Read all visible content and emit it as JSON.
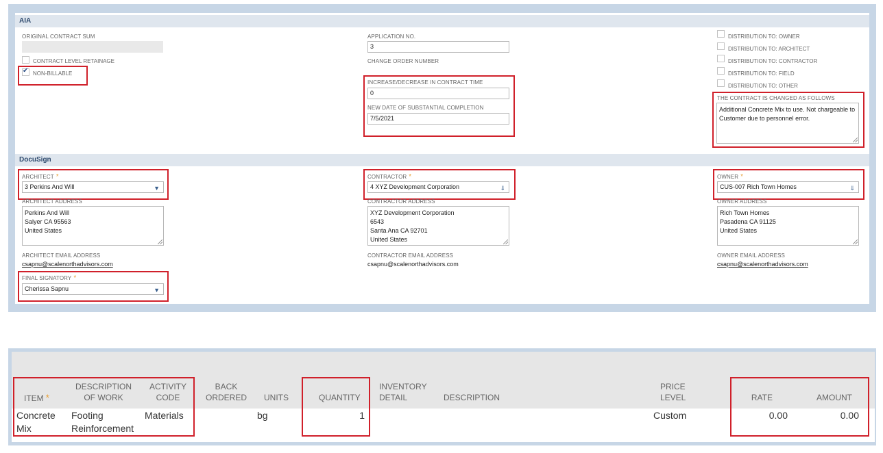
{
  "aia": {
    "section_title": "AIA",
    "original_contract_sum_label": "ORIGINAL CONTRACT SUM",
    "original_contract_sum_value": "",
    "contract_level_retainage_label": "CONTRACT LEVEL RETAINAGE",
    "contract_level_retainage_checked": false,
    "non_billable_label": "NON-BILLABLE",
    "non_billable_checked": true,
    "application_no_label": "APPLICATION NO.",
    "application_no_value": "3",
    "change_order_number_label": "CHANGE ORDER NUMBER",
    "contract_time_label": "INCREASE/DECREASE IN CONTRACT TIME",
    "contract_time_value": "0",
    "substantial_completion_label": "NEW DATE OF SUBSTANTIAL COMPLETION",
    "substantial_completion_value": "7/5/2021",
    "distribution": [
      {
        "label": "DISTRIBUTION TO: OWNER",
        "checked": false
      },
      {
        "label": "DISTRIBUTION TO: ARCHITECT",
        "checked": false
      },
      {
        "label": "DISTRIBUTION TO: CONTRACTOR",
        "checked": false
      },
      {
        "label": "DISTRIBUTION TO: FIELD",
        "checked": false
      },
      {
        "label": "DISTRIBUTION TO: OTHER",
        "checked": false
      }
    ],
    "contract_changed_label": "THE CONTRACT IS CHANGED AS FOLLOWS",
    "contract_changed_value": "Additional Concrete Mix to use. Not chargeable to Customer due to personnel error."
  },
  "docusign": {
    "section_title": "DocuSign",
    "required_mark": "*",
    "architect_label": "ARCHITECT",
    "architect_value": "3 Perkins And Will",
    "architect_address_label": "ARCHITECT ADDRESS",
    "architect_address_lines": [
      "Perkins And Will",
      "Salyer CA 95563",
      "United States"
    ],
    "architect_email_label": "ARCHITECT EMAIL ADDRESS",
    "architect_email": "csapnu@scalenorthadvisors.com",
    "final_signatory_label": "FINAL SIGNATORY",
    "final_signatory_value": "Cherissa Sapnu",
    "contractor_label": "CONTRACTOR",
    "contractor_value": "4 XYZ Development Corporation",
    "contractor_address_label": "CONTRACTOR ADDRESS",
    "contractor_address_lines": [
      "XYZ Development Corporation",
      "6543",
      "Santa Ana CA 92701",
      "United States"
    ],
    "contractor_email_label": "CONTRACTOR EMAIL ADDRESS",
    "contractor_email": "csapnu@scalenorthadvisors.com",
    "owner_label": "OWNER",
    "owner_value": "CUS-007 Rich Town Homes",
    "owner_address_label": "OWNER ADDRESS",
    "owner_address_lines": [
      "Rich Town Homes",
      "Pasadena CA 91125",
      "United States"
    ],
    "owner_email_label": "OWNER EMAIL ADDRESS",
    "owner_email": "csapnu@scalenorthadvisors.com"
  },
  "items_table": {
    "columns": {
      "item": "ITEM",
      "description_of_work": [
        "DESCRIPTION",
        "OF WORK"
      ],
      "activity_code": [
        "ACTIVITY",
        "CODE"
      ],
      "back_ordered": [
        "BACK",
        "ORDERED"
      ],
      "units": "UNITS",
      "quantity": "QUANTITY",
      "inventory_detail": [
        "INVENTORY",
        "DETAIL"
      ],
      "description": "DESCRIPTION",
      "price_level": [
        "PRICE",
        "LEVEL"
      ],
      "rate": "RATE",
      "amount": "AMOUNT"
    },
    "rows": [
      {
        "item": [
          "Concrete",
          "Mix"
        ],
        "description_of_work": [
          "Footing",
          "Reinforcement"
        ],
        "activity_code": "Materials",
        "back_ordered": "",
        "units": "bg",
        "quantity": "1",
        "inventory_detail": "",
        "description": "",
        "price_level": "Custom",
        "rate": "0.00",
        "amount": "0.00"
      }
    ]
  },
  "colors": {
    "highlight": "#d0202a",
    "panel_border": "#c7d6e6",
    "section_header_bg": "#dfe6ee",
    "required_star": "#e8a33d"
  }
}
